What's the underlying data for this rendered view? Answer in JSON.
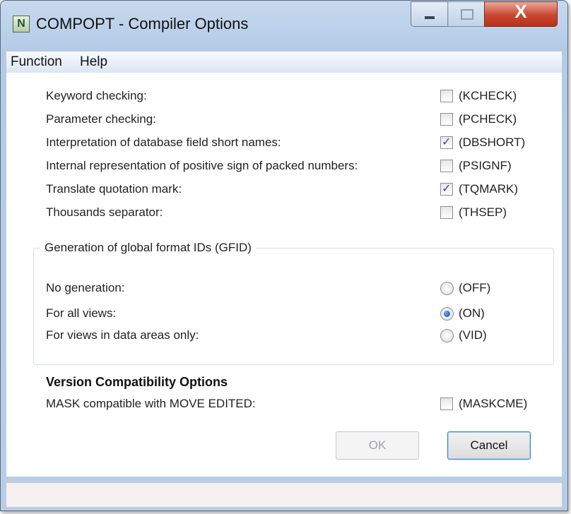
{
  "window": {
    "title": "COMPOPT - Compiler Options",
    "icon_letter": "N",
    "icon": "natural-app-icon",
    "close_glyph": "X"
  },
  "menu": [
    "Function",
    "Help"
  ],
  "options": [
    {
      "label": "Keyword checking:",
      "code": "(KCHECK)",
      "checked": false
    },
    {
      "label": "Parameter checking:",
      "code": "(PCHECK)",
      "checked": false
    },
    {
      "label": "Interpretation of database field short names:",
      "code": "(DBSHORT)",
      "checked": true
    },
    {
      "label": "Internal representation of positive sign of packed numbers:",
      "code": "(PSIGNF)",
      "checked": false
    },
    {
      "label": "Translate quotation mark:",
      "code": "(TQMARK)",
      "checked": true
    },
    {
      "label": "Thousands separator:",
      "code": "(THSEP)",
      "checked": false
    }
  ],
  "gfid": {
    "title": "Generation of global format IDs (GFID)",
    "choices": [
      {
        "label": "No generation:",
        "code": "(OFF)",
        "selected": false
      },
      {
        "label": "For all views:",
        "code": "(ON)",
        "selected": true
      },
      {
        "label": "For views in data areas only:",
        "code": "(VID)",
        "selected": false
      }
    ]
  },
  "version": {
    "heading": "Version Compatibility Options",
    "label": "MASK compatible with MOVE EDITED:",
    "code": "(MASKCME)",
    "checked": false
  },
  "buttons": {
    "ok": "OK",
    "cancel": "Cancel"
  },
  "check_glyph": "✓",
  "status_text": ""
}
